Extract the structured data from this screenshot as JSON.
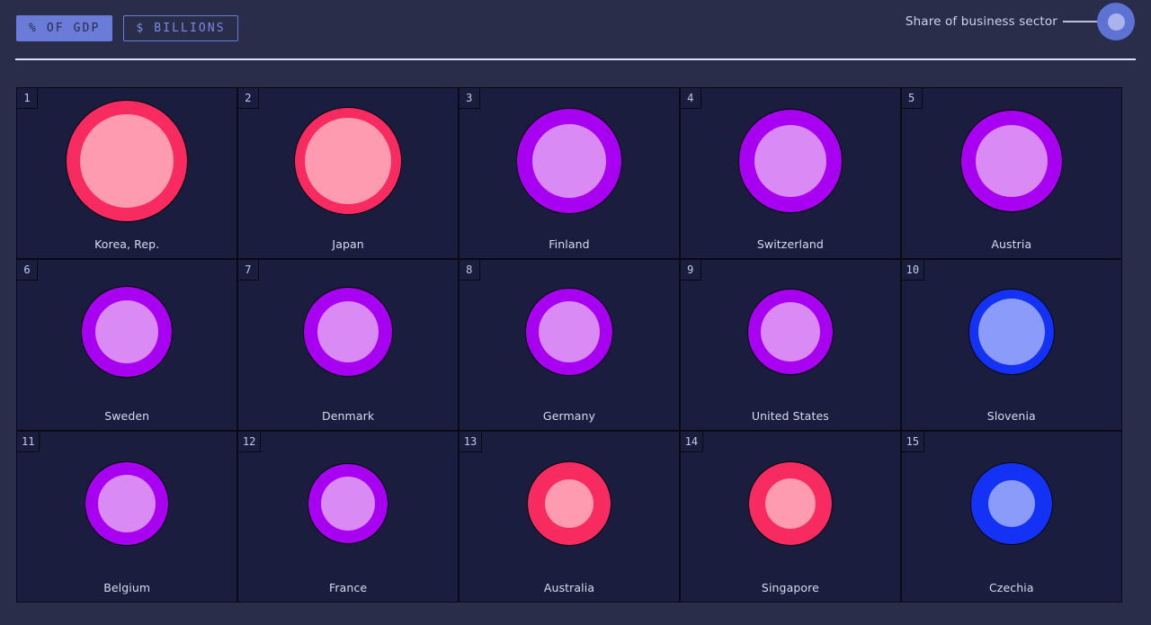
{
  "toolbar": {
    "units": [
      {
        "label": "% OF GDP",
        "active": true
      },
      {
        "label": "$ BILLIONS",
        "active": false
      }
    ]
  },
  "legend": {
    "switch_label": "Share of business sector",
    "switch_state": "on",
    "knob_color": "#5e72d4",
    "knob_inner_color": "#aab4ea"
  },
  "theme": {
    "page_background": "#2a2d4a",
    "cell_background": "#1a1d3d",
    "grid_line": "#0a0a14",
    "rule_color": "#dcdff0",
    "accent": "#6a7bd8",
    "text": "#d7dcf0"
  },
  "chart_data": {
    "type": "bubble",
    "title": "",
    "xlabel": "",
    "ylabel": "",
    "value_unit": "% OF GDP",
    "ring_meaning": "Share of business sector",
    "legend": [
      {
        "name": "pink",
        "ring": "#f72b60",
        "core": "#ff9bb0"
      },
      {
        "name": "purple",
        "ring": "#a800f0",
        "core": "#da8af5"
      },
      {
        "name": "blue",
        "ring": "#1432f5",
        "core": "#8a9bfa"
      }
    ],
    "categories": [
      "Korea, Rep.",
      "Japan",
      "Finland",
      "Switzerland",
      "Austria",
      "Sweden",
      "Denmark",
      "Germany",
      "United States",
      "Slovenia",
      "Belgium",
      "France",
      "Australia",
      "Singapore",
      "Czechia"
    ],
    "points": [
      {
        "rank": "1",
        "country": "Korea, Rep.",
        "outer": 134,
        "inner": 104,
        "ring": "#f72b60",
        "core": "#ff9bb0"
      },
      {
        "rank": "2",
        "country": "Japan",
        "outer": 118,
        "inner": 96,
        "ring": "#f72b60",
        "core": "#ff9bb0"
      },
      {
        "rank": "3",
        "country": "Finland",
        "outer": 116,
        "inner": 82,
        "ring": "#a800f0",
        "core": "#da8af5"
      },
      {
        "rank": "4",
        "country": "Switzerland",
        "outer": 114,
        "inner": 80,
        "ring": "#a800f0",
        "core": "#da8af5"
      },
      {
        "rank": "5",
        "country": "Austria",
        "outer": 112,
        "inner": 80,
        "ring": "#a800f0",
        "core": "#da8af5"
      },
      {
        "rank": "6",
        "country": "Sweden",
        "outer": 100,
        "inner": 70,
        "ring": "#a800f0",
        "core": "#da8af5"
      },
      {
        "rank": "7",
        "country": "Denmark",
        "outer": 98,
        "inner": 68,
        "ring": "#a800f0",
        "core": "#da8af5"
      },
      {
        "rank": "8",
        "country": "Germany",
        "outer": 96,
        "inner": 68,
        "ring": "#a800f0",
        "core": "#da8af5"
      },
      {
        "rank": "9",
        "country": "United States",
        "outer": 94,
        "inner": 66,
        "ring": "#a800f0",
        "core": "#da8af5"
      },
      {
        "rank": "10",
        "country": "Slovenia",
        "outer": 94,
        "inner": 74,
        "ring": "#1432f5",
        "core": "#8a9bfa"
      },
      {
        "rank": "11",
        "country": "Belgium",
        "outer": 92,
        "inner": 64,
        "ring": "#a800f0",
        "core": "#da8af5"
      },
      {
        "rank": "12",
        "country": "France",
        "outer": 88,
        "inner": 60,
        "ring": "#a800f0",
        "core": "#da8af5"
      },
      {
        "rank": "13",
        "country": "Australia",
        "outer": 92,
        "inner": 54,
        "ring": "#f72b60",
        "core": "#ff9bb0"
      },
      {
        "rank": "14",
        "country": "Singapore",
        "outer": 92,
        "inner": 56,
        "ring": "#f72b60",
        "core": "#ff9bb0"
      },
      {
        "rank": "15",
        "country": "Czechia",
        "outer": 90,
        "inner": 52,
        "ring": "#1432f5",
        "core": "#8a9bfa"
      }
    ]
  }
}
